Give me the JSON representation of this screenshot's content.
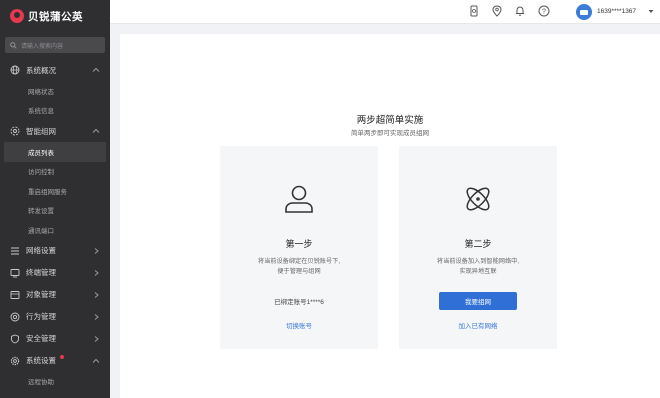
{
  "brand": {
    "name": "贝锐蒲公英",
    "accent": "#e8384f"
  },
  "search": {
    "placeholder": "请输入搜索内容"
  },
  "sidebar": {
    "groups": [
      {
        "label": "系统概况",
        "icon": "globe-icon",
        "expanded": true,
        "items": [
          "网络状态",
          "系统信息"
        ]
      },
      {
        "label": "智能组网",
        "icon": "network-icon",
        "expanded": true,
        "items": [
          "成员列表",
          "访问控制",
          "重启组网服务",
          "转发设置",
          "通讯端口"
        ],
        "active": "成员列表"
      },
      {
        "label": "网络设置",
        "icon": "list-icon"
      },
      {
        "label": "终端管理",
        "icon": "terminal-icon"
      },
      {
        "label": "对象管理",
        "icon": "object-icon"
      },
      {
        "label": "行为管理",
        "icon": "behavior-icon"
      },
      {
        "label": "安全管理",
        "icon": "shield-icon"
      },
      {
        "label": "系统设置",
        "icon": "gear-icon",
        "badge": true,
        "expanded": true,
        "items": [
          "远程协助"
        ]
      }
    ]
  },
  "header": {
    "icons": [
      "device-icon",
      "location-icon",
      "bell-icon",
      "help-icon"
    ],
    "user": "1639****1367"
  },
  "main": {
    "title": "两步超简单实施",
    "subtitle": "简单两步即可实现成员组网",
    "step1": {
      "icon": "user-icon",
      "title": "第一步",
      "desc_line1": "将当前设备绑定在贝锐账号下,",
      "desc_line2": "便于管理与组网",
      "bound": "已绑定账号1****6",
      "link": "切换账号"
    },
    "step2": {
      "icon": "atom-icon",
      "title": "第二步",
      "desc_line1": "将当前设备加入到智能网络中,",
      "desc_line2": "实现异地互联",
      "button": "我要组网",
      "link": "加入已有网络"
    }
  },
  "colors": {
    "sidebar_bg": "#2f2f31",
    "primary": "#2f6fd6",
    "link": "#3a77d9"
  }
}
